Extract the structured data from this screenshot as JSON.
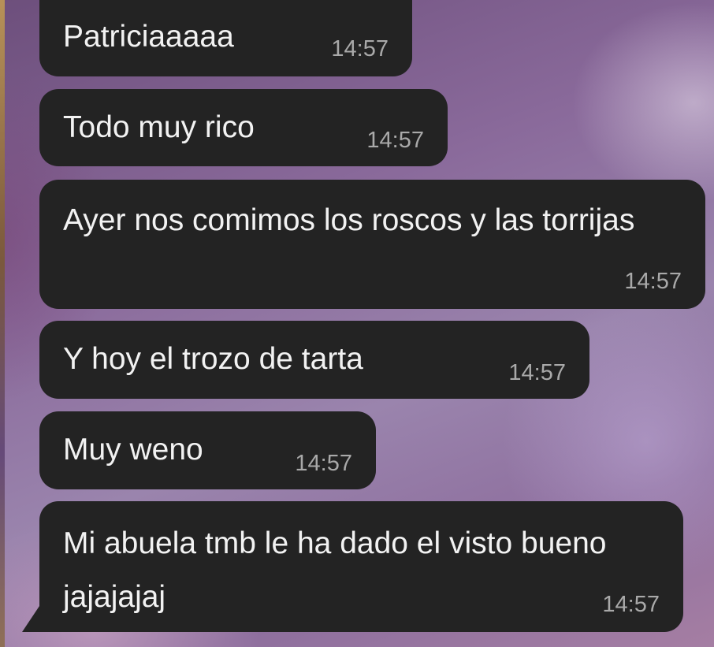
{
  "chat": {
    "messages": [
      {
        "text": "Patriciaaaaa",
        "time": "14:57"
      },
      {
        "text": "Todo muy rico",
        "time": "14:57"
      },
      {
        "text": "Ayer nos comimos los roscos y las torrijas",
        "time": "14:57"
      },
      {
        "text": "Y hoy el trozo de tarta",
        "time": "14:57"
      },
      {
        "text": "Muy weno",
        "time": "14:57"
      },
      {
        "text": "Mi abuela tmb le ha dado el visto bueno jajajajaj",
        "time": "14:57"
      }
    ]
  },
  "colors": {
    "bubble_background": "#232323",
    "message_text": "#f2f2f2",
    "timestamp_text": "#a9a9a9"
  }
}
